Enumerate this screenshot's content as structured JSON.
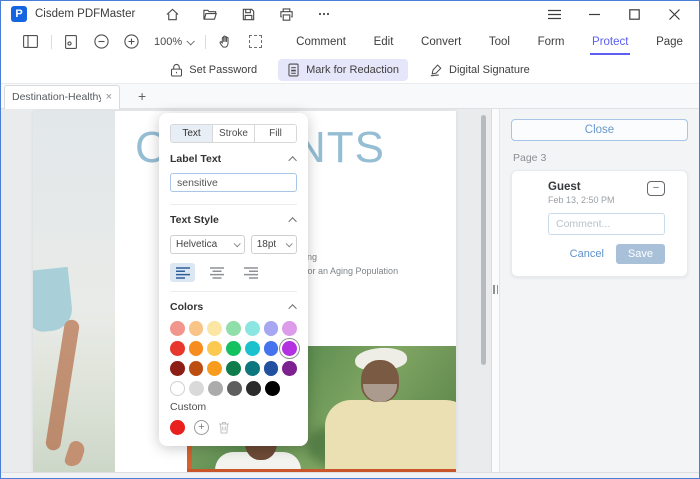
{
  "window": {
    "title": "Cisdem PDFMaster"
  },
  "toolbar": {
    "zoom_level": "100%",
    "menus": [
      "Comment",
      "Edit",
      "Convert",
      "Tool",
      "Form",
      "Protect",
      "Page"
    ],
    "active_menu": "Protect"
  },
  "protect_toolbar": {
    "items": [
      {
        "label": "Set Password"
      },
      {
        "label": "Mark for Redaction"
      },
      {
        "label": "Digital Signature"
      }
    ],
    "active_item": "Mark for Redaction"
  },
  "tabbar": {
    "document_tab": "Destination-Healthy-...",
    "close_glyph": "×",
    "add_glyph": "+"
  },
  "document": {
    "heading": "CONTENTS",
    "fragments": [
      "ing",
      "for an Aging Population"
    ]
  },
  "redaction_panel": {
    "tabs": [
      "Text",
      "Stroke",
      "Fill"
    ],
    "active_tab": "Text",
    "sections": {
      "label_text": "Label Text",
      "text_style": "Text Style",
      "colors": "Colors",
      "custom": "Custom"
    },
    "label_value": "sensitive",
    "font_family": "Helvetica",
    "font_size": "18pt",
    "palette": {
      "rows": [
        [
          "#F2968D",
          "#F8C488",
          "#FBE7A3",
          "#90DFAA",
          "#8BE6E2",
          "#A6A6F2",
          "#DC9CEA"
        ],
        [
          "#E8372D",
          "#F78D1E",
          "#FBC94F",
          "#13C160",
          "#1BC2CE",
          "#4573EE",
          "#B331E1"
        ],
        [
          "#8C1E16",
          "#BD4E12",
          "#F79C1C",
          "#0F7C4C",
          "#0E767D",
          "#20509F",
          "#7D2090"
        ],
        [
          "#FFFFFF",
          "#D9D9D9",
          "#ABABAB",
          "#5E5E5E",
          "#2B2B2B",
          "#000000"
        ]
      ],
      "selected": "#B331E1"
    },
    "custom_swatch": "#E8201E",
    "add_glyph": "+"
  },
  "sidebar": {
    "close_label": "Close",
    "page_label": "Page 3",
    "comment": {
      "author": "Guest",
      "timestamp": "Feb 13, 2:50 PM",
      "placeholder": "Comment...",
      "cancel_label": "Cancel",
      "save_label": "Save",
      "collapse_glyph": "−"
    }
  },
  "colors": {
    "accent_purple": "#5B5EF0",
    "active_tool_bg": "#E6E6FB",
    "link_blue": "#6394CC",
    "save_button_bg": "#A9C0D9",
    "heading_blue": "#95BED4"
  }
}
